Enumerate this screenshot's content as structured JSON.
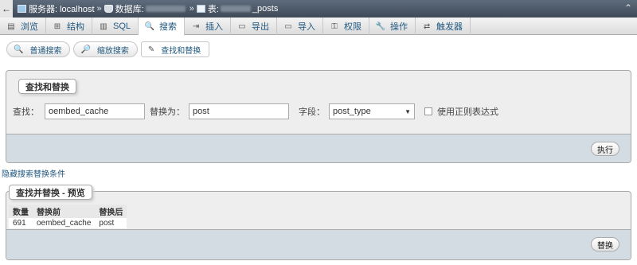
{
  "breadcrumb": {
    "back": "←",
    "server_label": "服务器: localhost",
    "db_label": "数据库:",
    "table_prefix": "表:",
    "table_suffix": "_posts",
    "sep": "»",
    "collapse": "⌃"
  },
  "tabs": [
    {
      "label": "浏览",
      "icon": "browse-icon",
      "glyph": "▤"
    },
    {
      "label": "结构",
      "icon": "structure-icon",
      "glyph": "⊞"
    },
    {
      "label": "SQL",
      "icon": "sql-icon",
      "glyph": "▥"
    },
    {
      "label": "搜索",
      "icon": "search-icon",
      "glyph": "🔍"
    },
    {
      "label": "插入",
      "icon": "insert-icon",
      "glyph": "⇥"
    },
    {
      "label": "导出",
      "icon": "export-icon",
      "glyph": "▭"
    },
    {
      "label": "导入",
      "icon": "import-icon",
      "glyph": "▭"
    },
    {
      "label": "权限",
      "icon": "privileges-icon",
      "glyph": "⚿"
    },
    {
      "label": "操作",
      "icon": "operations-icon",
      "glyph": "🔧"
    },
    {
      "label": "触发器",
      "icon": "triggers-icon",
      "glyph": "⇄"
    }
  ],
  "active_tab": 3,
  "subtabs": [
    {
      "label": "普通搜索",
      "icon": "search-icon",
      "glyph": "🔍"
    },
    {
      "label": "缩放搜索",
      "icon": "zoom-search-icon",
      "glyph": "🔎"
    },
    {
      "label": "查找和替换",
      "icon": "find-replace-icon",
      "glyph": "✎"
    }
  ],
  "find_replace": {
    "legend": "查找和替换",
    "find_label": "查找：",
    "find_value": "oembed_cache",
    "replace_label": "替换为：",
    "replace_value": "post",
    "field_label": "字段：",
    "field_value": "post_type",
    "regex_label": "使用正则表达式",
    "go_button": "执行"
  },
  "hide_criteria_link": "隐藏搜索替换条件",
  "preview": {
    "legend": "查找并替换 - 预览",
    "headers": [
      "数量",
      "替换前",
      "替换后"
    ],
    "rows": [
      [
        "691",
        "oembed_cache",
        "post"
      ]
    ],
    "replace_button": "替换"
  }
}
